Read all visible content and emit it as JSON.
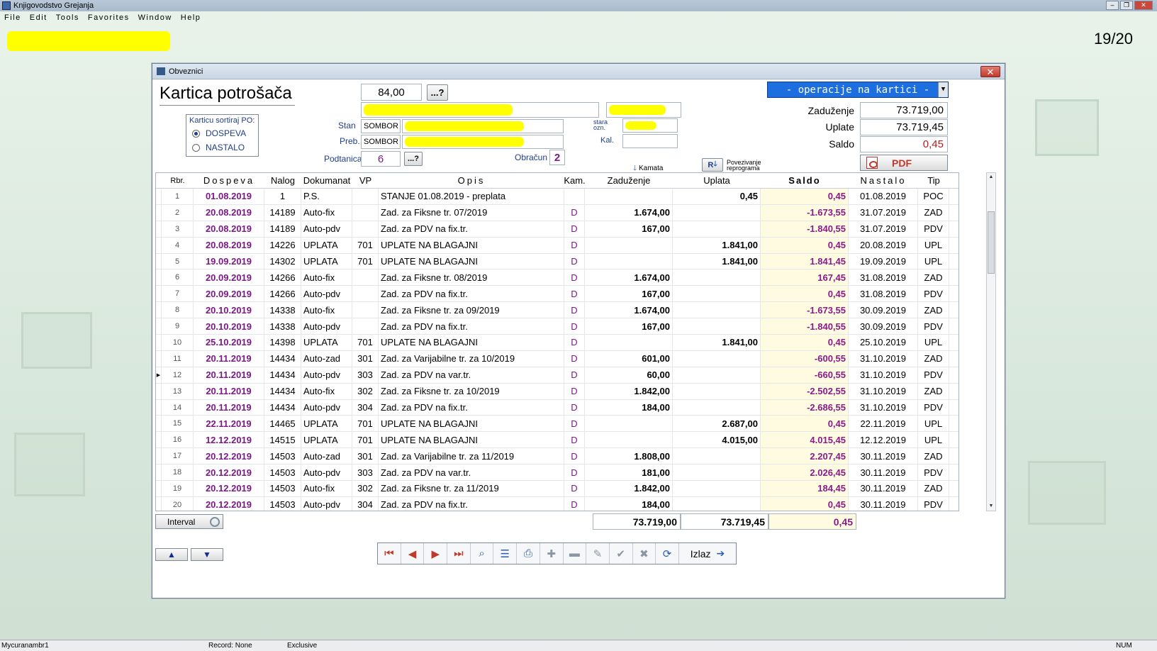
{
  "app": {
    "title": "Knjigovodstvo Grejanja",
    "menu": [
      "File",
      "Edit",
      "Tools",
      "Favorites",
      "Window",
      "Help"
    ],
    "page_counter": "19/20"
  },
  "dialog": {
    "title": "Obveznici",
    "heading": "Kartica potrošača",
    "amount": "84,00",
    "browse_label": "...?",
    "sort_group": {
      "legend": "Karticu sortiraj PO:",
      "options": [
        "DOSPEVA",
        "NASTALO"
      ],
      "selected": "DOSPEVA"
    },
    "fields": {
      "stan_label": "Stan",
      "stan_city": "SOMBOR",
      "preb_label": "Preb.",
      "preb_city": "SOMBOR",
      "podtanica_label": "Podtanica",
      "podtanica_value": "6",
      "obracun_label": "Obračun",
      "obracun_value": "2",
      "stara_ozn_label": "stara ozn.",
      "kal_label": "Kal."
    },
    "ops_label": "- operacije na kartici -",
    "summary": {
      "zaduzenje_label": "Zaduženje",
      "zaduzenje_value": "73.719,00",
      "uplate_label": "Uplate",
      "uplate_value": "73.719,45",
      "saldo_label": "Saldo",
      "saldo_value": "0,45"
    },
    "pdf_label": "PDF",
    "kamata_label": "Kamata",
    "reprogram_label_1": "Povezivanje",
    "reprogram_label_2": "reprograma",
    "reprogram_btn": "R",
    "columns": [
      "Rbr.",
      "Dospeva",
      "Nalog",
      "Dokumanat",
      "VP",
      "Opis",
      "Kam.",
      "Zaduženje",
      "Uplata",
      "Saldo",
      "Nastalo",
      "Tip"
    ],
    "rows": [
      {
        "rbr": "1",
        "dos": "01.08.2019",
        "nal": "1",
        "dok": "P.S.",
        "vp": "",
        "opi": "STANJE 01.08.2019 - preplata",
        "kam": "",
        "zad": "",
        "upl": "0,45",
        "sal": "0,45",
        "nas": "01.08.2019",
        "tip": "POC"
      },
      {
        "rbr": "2",
        "dos": "20.08.2019",
        "nal": "14189",
        "dok": "Auto-fix",
        "vp": "",
        "opi": "Zad. za Fiksne tr. 07/2019",
        "kam": "D",
        "zad": "1.674,00",
        "upl": "",
        "sal": "-1.673,55",
        "nas": "31.07.2019",
        "tip": "ZAD"
      },
      {
        "rbr": "3",
        "dos": "20.08.2019",
        "nal": "14189",
        "dok": "Auto-pdv",
        "vp": "",
        "opi": "Zad. za PDV na fix.tr.",
        "kam": "D",
        "zad": "167,00",
        "upl": "",
        "sal": "-1.840,55",
        "nas": "31.07.2019",
        "tip": "PDV"
      },
      {
        "rbr": "4",
        "dos": "20.08.2019",
        "nal": "14226",
        "dok": "UPLATA",
        "vp": "701",
        "opi": "UPLATE NA BLAGAJNI",
        "kam": "D",
        "zad": "",
        "upl": "1.841,00",
        "sal": "0,45",
        "nas": "20.08.2019",
        "tip": "UPL"
      },
      {
        "rbr": "5",
        "dos": "19.09.2019",
        "nal": "14302",
        "dok": "UPLATA",
        "vp": "701",
        "opi": "UPLATE NA BLAGAJNI",
        "kam": "D",
        "zad": "",
        "upl": "1.841,00",
        "sal": "1.841,45",
        "nas": "19.09.2019",
        "tip": "UPL"
      },
      {
        "rbr": "6",
        "dos": "20.09.2019",
        "nal": "14266",
        "dok": "Auto-fix",
        "vp": "",
        "opi": "Zad. za Fiksne tr. 08/2019",
        "kam": "D",
        "zad": "1.674,00",
        "upl": "",
        "sal": "167,45",
        "nas": "31.08.2019",
        "tip": "ZAD"
      },
      {
        "rbr": "7",
        "dos": "20.09.2019",
        "nal": "14266",
        "dok": "Auto-pdv",
        "vp": "",
        "opi": "Zad. za PDV na fix.tr.",
        "kam": "D",
        "zad": "167,00",
        "upl": "",
        "sal": "0,45",
        "nas": "31.08.2019",
        "tip": "PDV"
      },
      {
        "rbr": "8",
        "dos": "20.10.2019",
        "nal": "14338",
        "dok": "Auto-fix",
        "vp": "",
        "opi": "Zad. za Fiksne tr. za 09/2019",
        "kam": "D",
        "zad": "1.674,00",
        "upl": "",
        "sal": "-1.673,55",
        "nas": "30.09.2019",
        "tip": "ZAD"
      },
      {
        "rbr": "9",
        "dos": "20.10.2019",
        "nal": "14338",
        "dok": "Auto-pdv",
        "vp": "",
        "opi": "Zad. za PDV na fix.tr.",
        "kam": "D",
        "zad": "167,00",
        "upl": "",
        "sal": "-1.840,55",
        "nas": "30.09.2019",
        "tip": "PDV"
      },
      {
        "rbr": "10",
        "dos": "25.10.2019",
        "nal": "14398",
        "dok": "UPLATA",
        "vp": "701",
        "opi": "UPLATE NA BLAGAJNI",
        "kam": "D",
        "zad": "",
        "upl": "1.841,00",
        "sal": "0,45",
        "nas": "25.10.2019",
        "tip": "UPL"
      },
      {
        "rbr": "11",
        "dos": "20.11.2019",
        "nal": "14434",
        "dok": "Auto-zad",
        "vp": "301",
        "opi": "Zad. za Varijabilne tr. za 10/2019",
        "kam": "D",
        "zad": "601,00",
        "upl": "",
        "sal": "-600,55",
        "nas": "31.10.2019",
        "tip": "ZAD"
      },
      {
        "rbr": "12",
        "dos": "20.11.2019",
        "nal": "14434",
        "dok": "Auto-pdv",
        "vp": "303",
        "opi": "Zad. za PDV na var.tr.",
        "kam": "D",
        "zad": "60,00",
        "upl": "",
        "sal": "-660,55",
        "nas": "31.10.2019",
        "tip": "PDV"
      },
      {
        "rbr": "13",
        "dos": "20.11.2019",
        "nal": "14434",
        "dok": "Auto-fix",
        "vp": "302",
        "opi": "Zad. za Fiksne tr. za 10/2019",
        "kam": "D",
        "zad": "1.842,00",
        "upl": "",
        "sal": "-2.502,55",
        "nas": "31.10.2019",
        "tip": "ZAD"
      },
      {
        "rbr": "14",
        "dos": "20.11.2019",
        "nal": "14434",
        "dok": "Auto-pdv",
        "vp": "304",
        "opi": "Zad. za PDV na fix.tr.",
        "kam": "D",
        "zad": "184,00",
        "upl": "",
        "sal": "-2.686,55",
        "nas": "31.10.2019",
        "tip": "PDV"
      },
      {
        "rbr": "15",
        "dos": "22.11.2019",
        "nal": "14465",
        "dok": "UPLATA",
        "vp": "701",
        "opi": "UPLATE NA BLAGAJNI",
        "kam": "D",
        "zad": "",
        "upl": "2.687,00",
        "sal": "0,45",
        "nas": "22.11.2019",
        "tip": "UPL"
      },
      {
        "rbr": "16",
        "dos": "12.12.2019",
        "nal": "14515",
        "dok": "UPLATA",
        "vp": "701",
        "opi": "UPLATE NA BLAGAJNI",
        "kam": "D",
        "zad": "",
        "upl": "4.015,00",
        "sal": "4.015,45",
        "nas": "12.12.2019",
        "tip": "UPL"
      },
      {
        "rbr": "17",
        "dos": "20.12.2019",
        "nal": "14503",
        "dok": "Auto-zad",
        "vp": "301",
        "opi": "Zad. za Varijabilne tr. za 11/2019",
        "kam": "D",
        "zad": "1.808,00",
        "upl": "",
        "sal": "2.207,45",
        "nas": "30.11.2019",
        "tip": "ZAD"
      },
      {
        "rbr": "18",
        "dos": "20.12.2019",
        "nal": "14503",
        "dok": "Auto-pdv",
        "vp": "303",
        "opi": "Zad. za PDV na var.tr.",
        "kam": "D",
        "zad": "181,00",
        "upl": "",
        "sal": "2.026,45",
        "nas": "30.11.2019",
        "tip": "PDV"
      },
      {
        "rbr": "19",
        "dos": "20.12.2019",
        "nal": "14503",
        "dok": "Auto-fix",
        "vp": "302",
        "opi": "Zad. za Fiksne tr. za 11/2019",
        "kam": "D",
        "zad": "1.842,00",
        "upl": "",
        "sal": "184,45",
        "nas": "30.11.2019",
        "tip": "ZAD"
      },
      {
        "rbr": "20",
        "dos": "20.12.2019",
        "nal": "14503",
        "dok": "Auto-pdv",
        "vp": "304",
        "opi": "Zad. za PDV na fix.tr.",
        "kam": "D",
        "zad": "184,00",
        "upl": "",
        "sal": "0,45",
        "nas": "30.11.2019",
        "tip": "PDV"
      }
    ],
    "totals": {
      "zaduzenje": "73.719,00",
      "uplata": "73.719,45",
      "saldo": "0,45"
    },
    "interval_label": "Interval",
    "izlaz_label": "Izlaz"
  },
  "statusbar": {
    "user": "Mycuranambr1",
    "record": "Record: None",
    "mode": "Exclusive",
    "num": "NUM"
  },
  "colors": {
    "accent_blue": "#1d6fe0",
    "date_purple": "#7b1a86",
    "saldo_bg": "#fffbe0",
    "label_blue": "#1f3d8a"
  }
}
